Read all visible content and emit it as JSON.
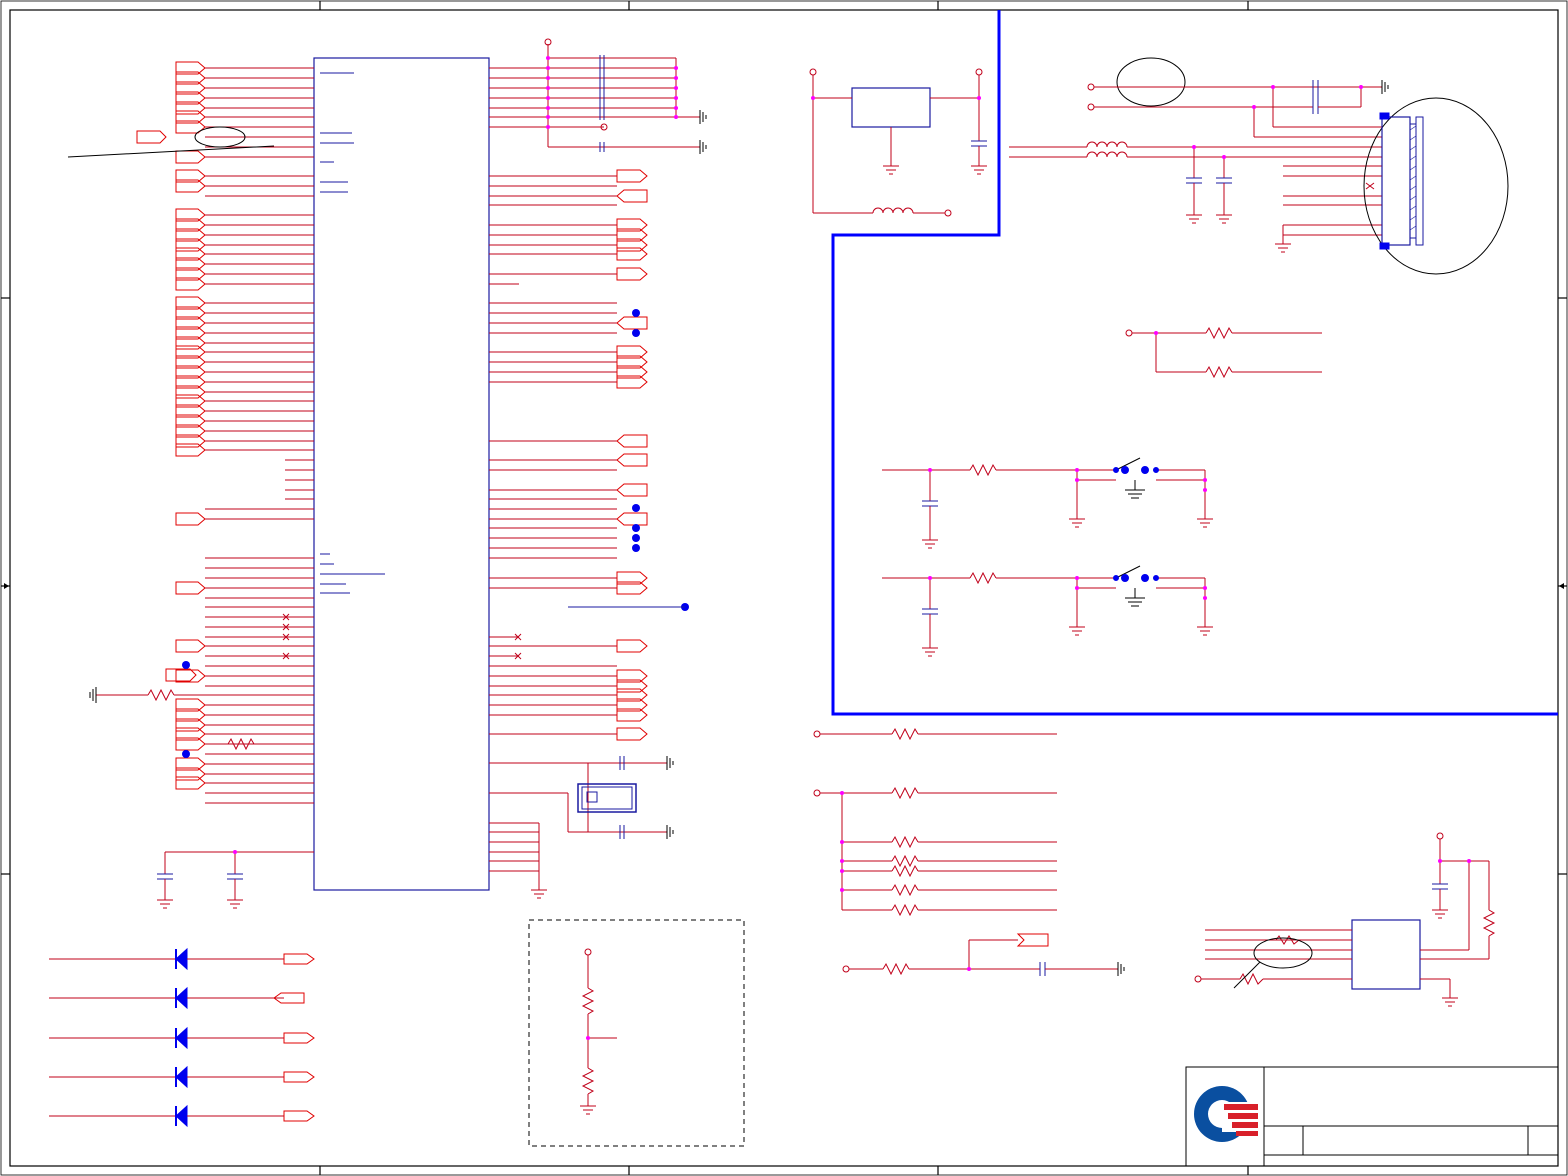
{
  "sheet": {
    "title_block": {
      "company_logo": "quanta-logo",
      "title": "",
      "size": "",
      "document_number": "",
      "rev": ""
    }
  },
  "colors": {
    "net_wire": "#c0001a",
    "bus_wire": "#1a1aa0",
    "port_flag": "#e00000",
    "junction": "#ff00ff",
    "block_border": "#0000ff",
    "frame": "#000000",
    "logo_blue": "#0a4fa0",
    "logo_red": "#d8202a"
  }
}
